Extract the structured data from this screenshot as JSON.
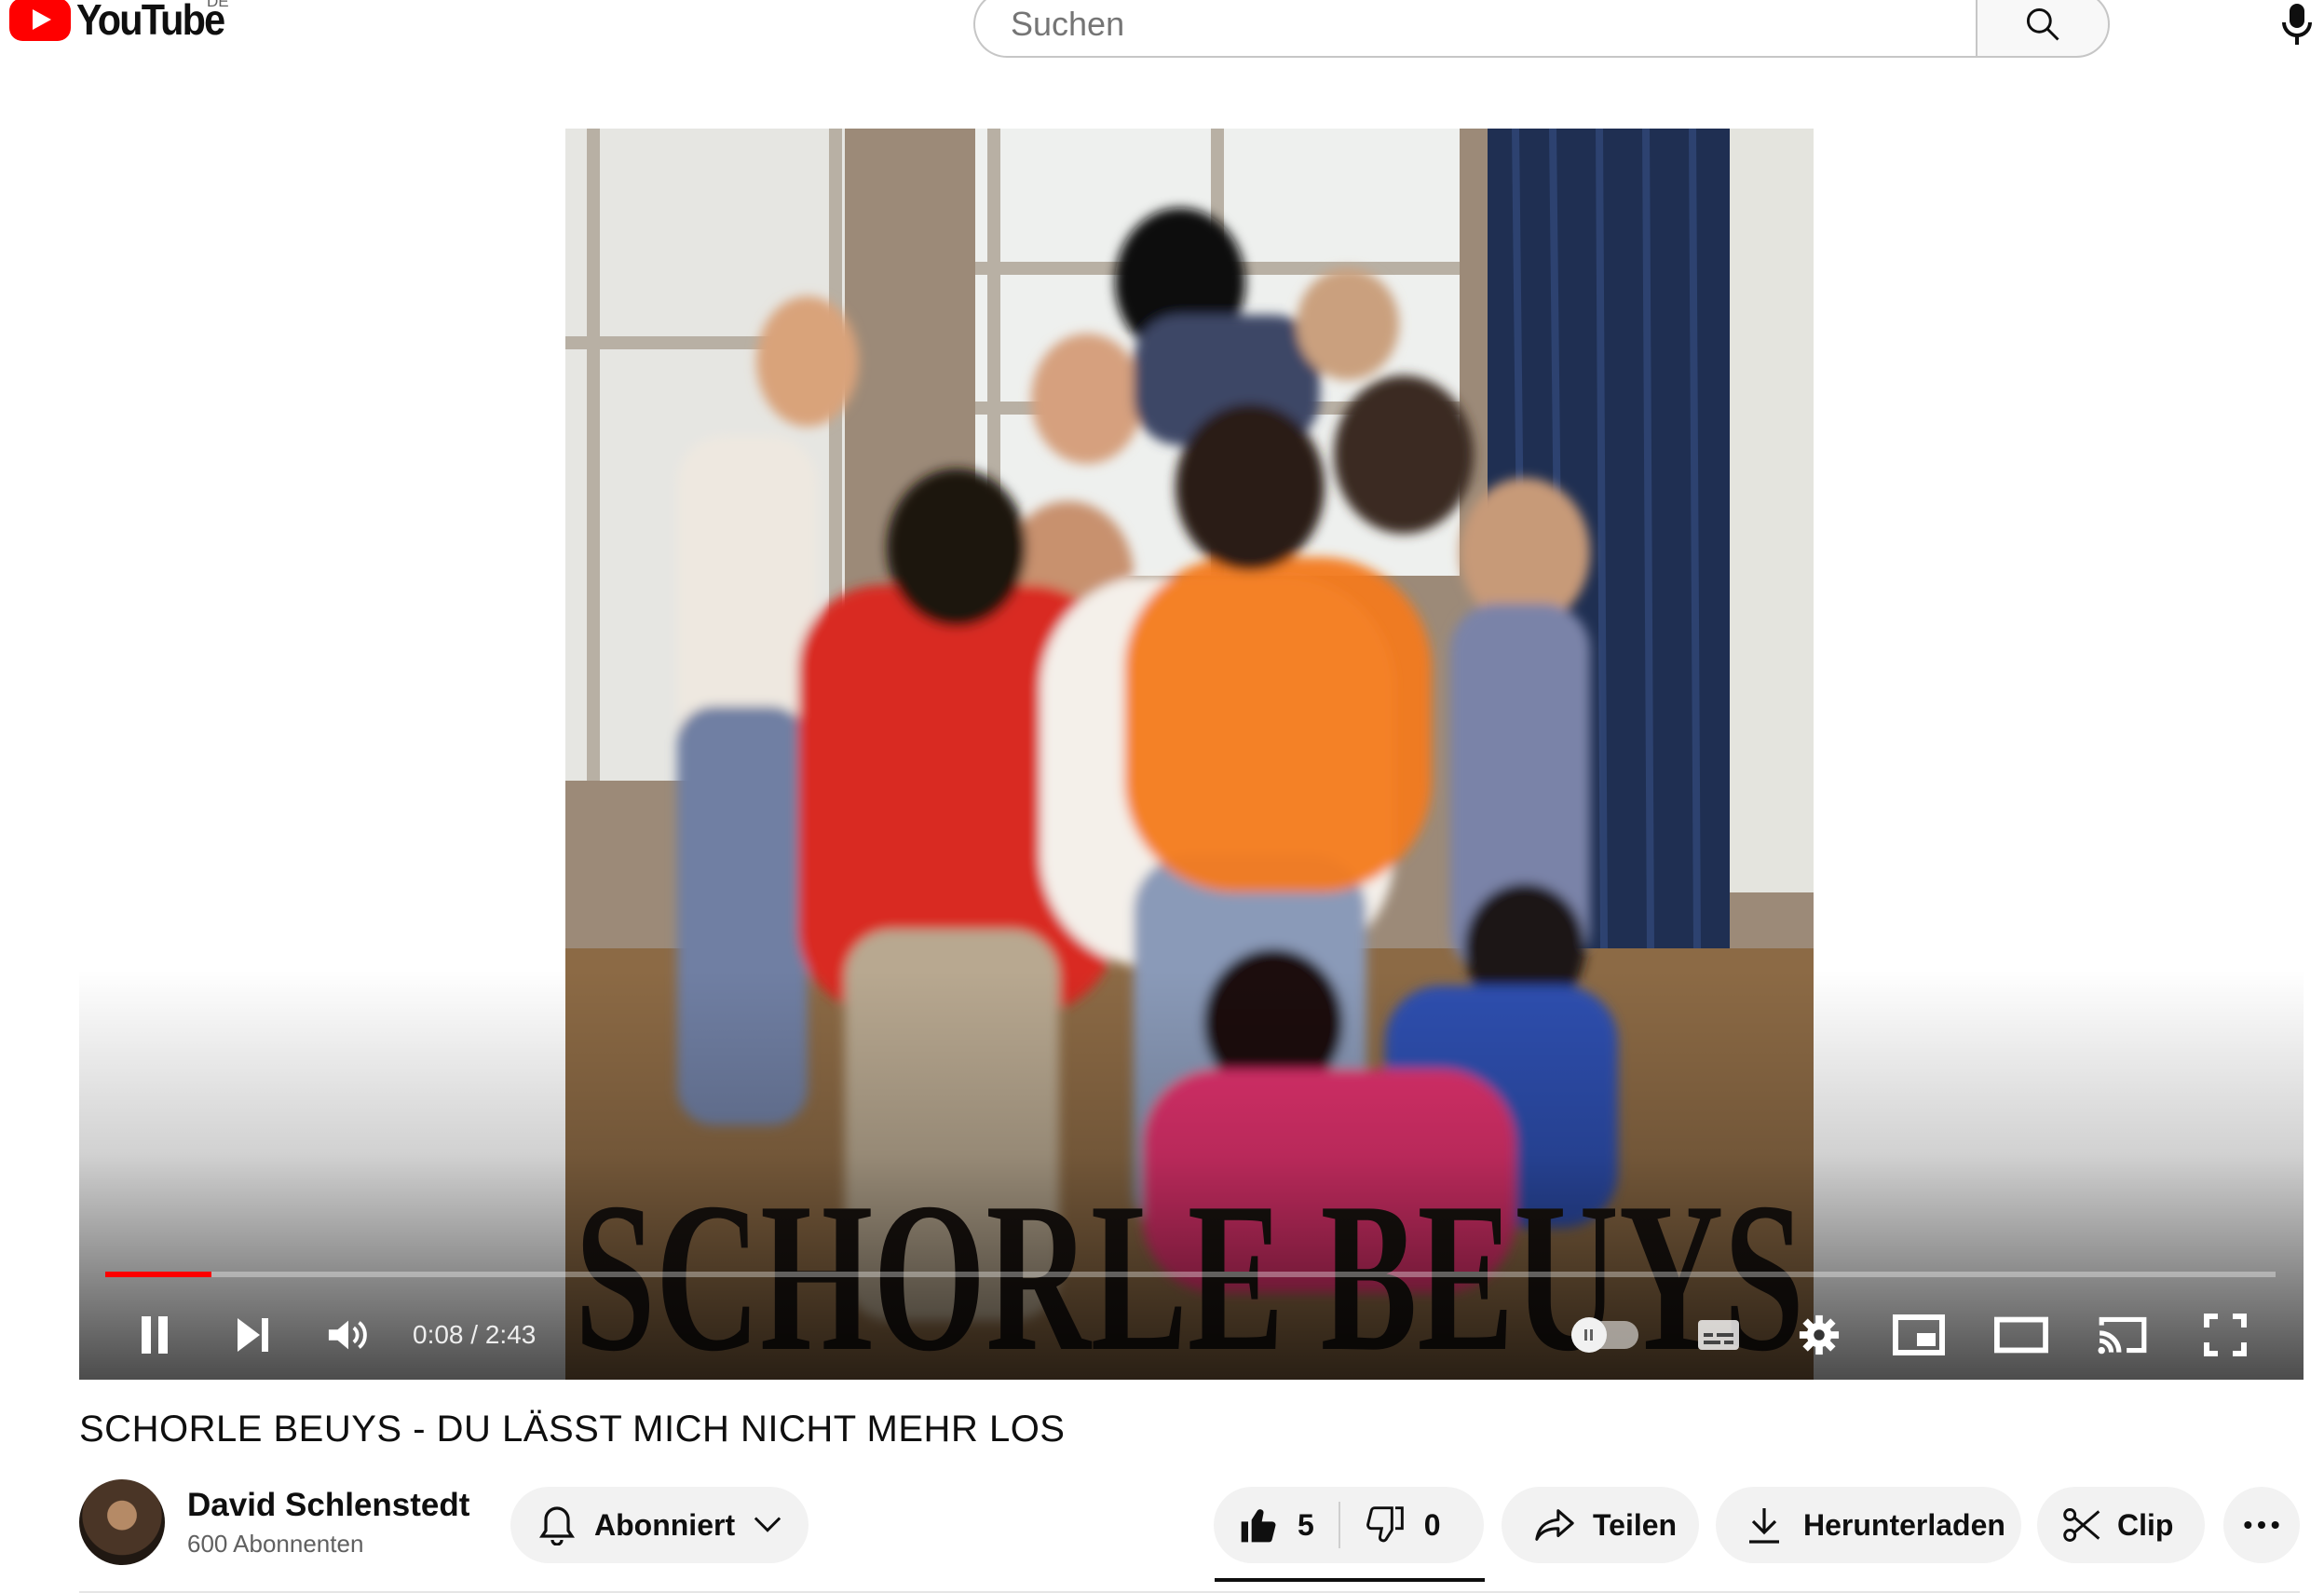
{
  "header": {
    "logo_text": "YouTube",
    "region": "DE",
    "search_placeholder": "Suchen"
  },
  "player": {
    "overlay_text": "SCHORLE BEUYS",
    "current_time": "0:08",
    "separator": " / ",
    "duration": "2:43",
    "progress_fraction": 0.049,
    "progress_color": "#ff0000"
  },
  "video": {
    "title": "SCHORLE BEUYS - DU LÄSST MICH NICHT MEHR LOS"
  },
  "channel": {
    "name": "David Schlenstedt",
    "subscribers": "600 Abonnenten",
    "subscribe_label": "Abonniert"
  },
  "actions": {
    "likes": "5",
    "dislikes": "0",
    "share_label": "Teilen",
    "download_label": "Herunterladen",
    "clip_label": "Clip"
  },
  "icons": [
    "search-icon",
    "mic-icon",
    "pause-icon",
    "next-icon",
    "volume-icon",
    "autoplay-toggle",
    "subtitles-icon",
    "settings-gear-icon",
    "miniplayer-icon",
    "theater-mode-icon",
    "cast-icon",
    "fullscreen-icon",
    "bell-icon",
    "chevron-down-icon",
    "thumbs-up-icon",
    "thumbs-down-icon",
    "share-icon",
    "download-icon",
    "scissors-icon",
    "more-icon"
  ]
}
